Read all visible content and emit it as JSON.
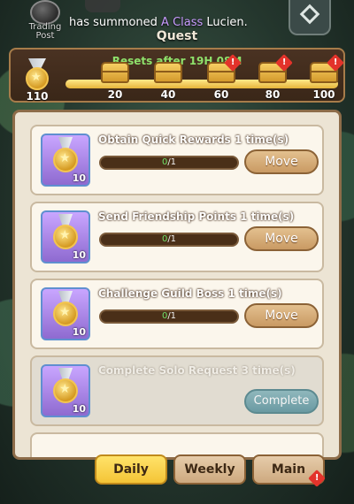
{
  "top_bar": {
    "trading_post_label": "Trading Post",
    "announcement": {
      "prefix": "has summoned",
      "highlight": "A Class",
      "suffix": "Lucien."
    }
  },
  "title": "Quest",
  "progress": {
    "reset_text": "Resets after 19H  08M",
    "current_points": "110",
    "max_points": 100,
    "milestones": [
      {
        "value": "20",
        "alert": false
      },
      {
        "value": "40",
        "alert": false
      },
      {
        "value": "60",
        "alert": true
      },
      {
        "value": "80",
        "alert": true
      },
      {
        "value": "100",
        "alert": true
      }
    ],
    "alert_glyph": "!"
  },
  "quests": [
    {
      "name": "Obtain Quick Rewards 1 time(s)",
      "progress_current": "0",
      "progress_total": "/1",
      "reward_count": "10",
      "action": "Move",
      "done": false
    },
    {
      "name": "Send Friendship Points 1 time(s)",
      "progress_current": "0",
      "progress_total": "/1",
      "reward_count": "10",
      "action": "Move",
      "done": false
    },
    {
      "name": "Challenge Guild Boss 1 time(s)",
      "progress_current": "0",
      "progress_total": "/1",
      "reward_count": "10",
      "action": "Move",
      "done": false
    },
    {
      "name": "Complete Solo Request 3 time(s)",
      "progress_current": "",
      "progress_total": "",
      "reward_count": "10",
      "action": "Complete",
      "done": true
    }
  ],
  "tabs": [
    {
      "label": "Daily",
      "active": true,
      "alert": false
    },
    {
      "label": "Weekly",
      "active": false,
      "alert": false
    },
    {
      "label": "Main",
      "active": false,
      "alert": true
    }
  ],
  "colors": {
    "reset_text": "#8ee16b",
    "highlight": "#c99bff",
    "progress_green": "#6fe06a",
    "alert_red": "#e3332b",
    "tab_active": "#f4c436"
  },
  "icons": {
    "trading_post": "trading-post-icon",
    "medal": "medal-icon",
    "chest": "chest-icon",
    "alert": "alert-icon",
    "menu": "diamond-menu-icon"
  }
}
